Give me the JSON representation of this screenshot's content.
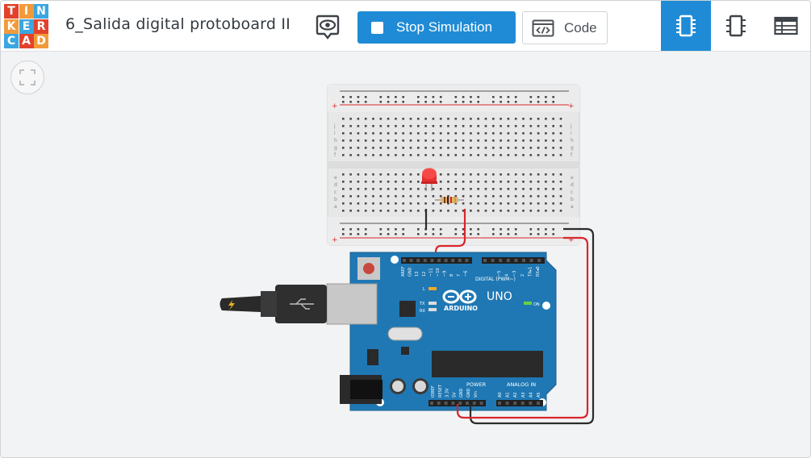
{
  "app": {
    "logo_letters": [
      "T",
      "I",
      "N",
      "K",
      "E",
      "R",
      "C",
      "A",
      "D"
    ],
    "logo_colors": [
      "#e2422b",
      "#f29a3a",
      "#3ba6e0",
      "#f29a3a",
      "#3ba6e0",
      "#e2422b",
      "#3ba6e0",
      "#e2422b",
      "#f29a3a"
    ],
    "title": "6_Salida digital protoboard II"
  },
  "toolbar": {
    "stop_label": "Stop Simulation",
    "code_label": "Code",
    "accent": "#1f8bd6",
    "views": [
      {
        "name": "schematic-view-icon",
        "active": true
      },
      {
        "name": "component-list-icon",
        "active": false
      },
      {
        "name": "netlist-table-icon",
        "active": false
      }
    ]
  },
  "circuit": {
    "arduino_brand": "ARDUINO",
    "arduino_model": "UNO",
    "header_digital": "DIGITAL (PWM~)",
    "header_power": "POWER",
    "header_analog": "ANALOG IN",
    "pin_labels_digital": [
      "AREF",
      "GND",
      "13",
      "12",
      "~11",
      "~10",
      "~9",
      "8",
      "7",
      "~6",
      "~5",
      "4",
      "~3",
      "2",
      "TX▸1",
      "RX◂0"
    ],
    "pin_labels_power": [
      "IOREF",
      "RESET",
      "3.3V",
      "5V",
      "GND",
      "GND",
      "Vin"
    ],
    "pin_labels_analog": [
      "A0",
      "A1",
      "A2",
      "A3",
      "A4",
      "A5"
    ],
    "led_labels": [
      "L",
      "TX",
      "RX",
      "ON"
    ],
    "breadboard_rows_top": [
      "j",
      "i",
      "h",
      "g",
      "f"
    ],
    "breadboard_rows_bottom": [
      "e",
      "d",
      "c",
      "b",
      "a"
    ],
    "wire_colors": {
      "red": "#d9262b",
      "black": "#2b2b2b"
    },
    "led_color": "#e8302f"
  }
}
